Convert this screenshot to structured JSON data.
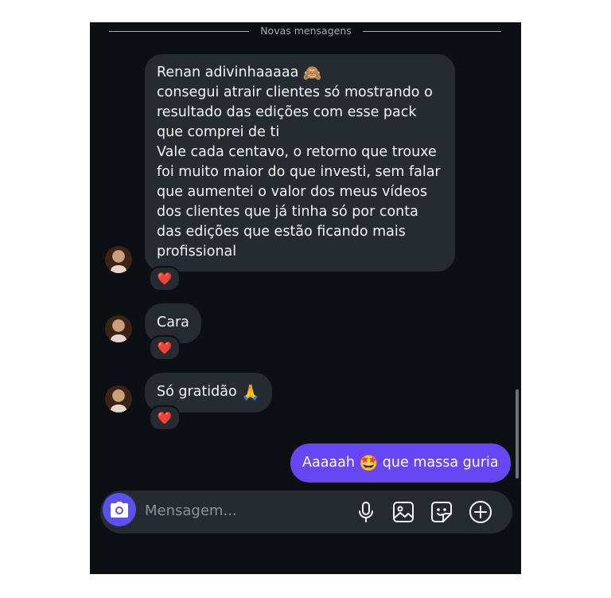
{
  "divider": {
    "label": "Novas mensagens"
  },
  "messages": [
    {
      "sender": "other",
      "lines": "Renan adivinhaaaaa",
      "emoji": "🙈",
      "continuation": "consegui atrair clientes só mostrando o\nresultado das edições com esse pack\nque comprei de ti\nVale cada centavo, o retorno que trouxe\nfoi muito maior do que investi, sem falar\nque aumentei o valor dos meus vídeos\ndos clientes que já tinha só por conta\ndas edições que estão ficando mais\nprofissional",
      "reaction": "❤️"
    },
    {
      "sender": "other",
      "text": "Cara",
      "reaction": "❤️"
    },
    {
      "sender": "other",
      "text": "Só gratidão",
      "emoji": "🙏",
      "reaction": "❤️"
    },
    {
      "sender": "me",
      "text_before": "Aaaaah",
      "emoji": "🤩",
      "text_after": "que massa guria"
    }
  ],
  "composer": {
    "placeholder": "Mensagem...",
    "icons": [
      "camera-icon",
      "microphone-icon",
      "image-icon",
      "sticker-icon",
      "plus-circle-icon"
    ]
  },
  "colors": {
    "background": "#0c1014",
    "received_bubble": "#262a31",
    "sent_bubble": "#6646f5",
    "camera_button": "#5b51f0"
  }
}
